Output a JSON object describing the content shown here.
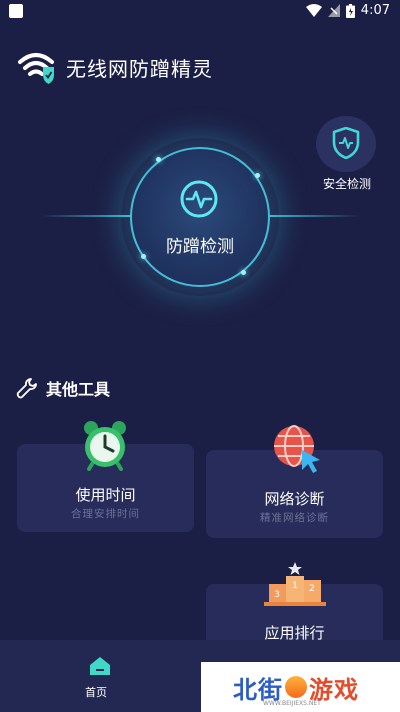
{
  "status_bar": {
    "time": "4:07"
  },
  "header": {
    "title": "无线网防蹭精灵"
  },
  "detect": {
    "label": "防蹭检测"
  },
  "security": {
    "label": "安全检测"
  },
  "tools": {
    "title": "其他工具",
    "cards": [
      {
        "title": "使用时间",
        "subtitle": "合理安排时间"
      },
      {
        "title": "网络诊断",
        "subtitle": "精准网络诊断"
      },
      {
        "title": "应用排行"
      }
    ]
  },
  "bottom_nav": {
    "home_label": "首页"
  },
  "watermark": {
    "text_blue": "北街",
    "text_red": "游戏",
    "url": "WWW.BEIJIEXS.NET"
  },
  "colors": {
    "background": "#1c1f45",
    "accent": "#40dcf0",
    "card": "#272c5a"
  },
  "icons": [
    "wifi-shield-icon",
    "pulse-icon",
    "shield-pulse-icon",
    "wrench-icon",
    "alarm-clock-icon",
    "globe-cursor-icon",
    "podium-icon",
    "home-icon"
  ]
}
